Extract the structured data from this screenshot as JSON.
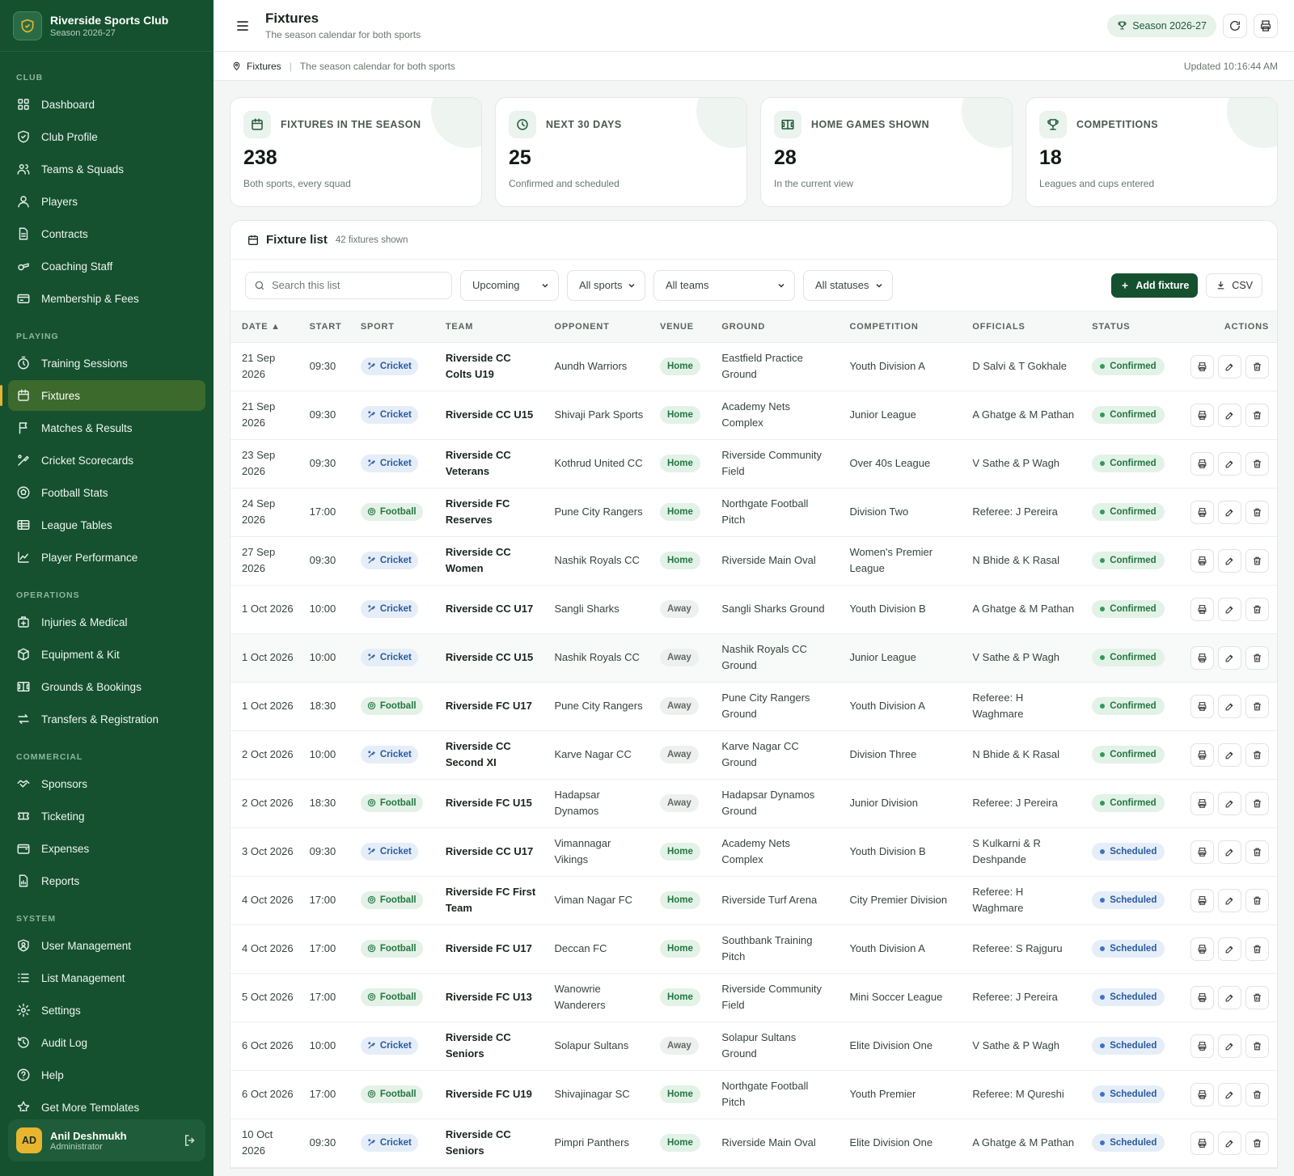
{
  "brand": {
    "name": "Riverside Sports Club",
    "season": "Season 2026-27"
  },
  "nav": {
    "sections": [
      {
        "label": "CLUB",
        "items": [
          {
            "label": "Dashboard",
            "icon": "grid-icon"
          },
          {
            "label": "Club Profile",
            "icon": "shield-icon"
          },
          {
            "label": "Teams & Squads",
            "icon": "users-icon"
          },
          {
            "label": "Players",
            "icon": "user-icon"
          },
          {
            "label": "Contracts",
            "icon": "document-icon"
          },
          {
            "label": "Coaching Staff",
            "icon": "whistle-icon"
          },
          {
            "label": "Membership & Fees",
            "icon": "card-icon"
          }
        ]
      },
      {
        "label": "PLAYING",
        "items": [
          {
            "label": "Training Sessions",
            "icon": "timer-icon"
          },
          {
            "label": "Fixtures",
            "icon": "calendar-icon",
            "active": true
          },
          {
            "label": "Matches & Results",
            "icon": "flag-icon"
          },
          {
            "label": "Cricket Scorecards",
            "icon": "bat-icon"
          },
          {
            "label": "Football Stats",
            "icon": "ball-icon"
          },
          {
            "label": "League Tables",
            "icon": "table-icon"
          },
          {
            "label": "Player Performance",
            "icon": "chart-icon"
          }
        ]
      },
      {
        "label": "OPERATIONS",
        "items": [
          {
            "label": "Injuries & Medical",
            "icon": "medical-icon"
          },
          {
            "label": "Equipment & Kit",
            "icon": "box-icon"
          },
          {
            "label": "Grounds & Bookings",
            "icon": "pitch-icon"
          },
          {
            "label": "Transfers & Registration",
            "icon": "transfer-icon"
          }
        ]
      },
      {
        "label": "COMMERCIAL",
        "items": [
          {
            "label": "Sponsors",
            "icon": "handshake-icon"
          },
          {
            "label": "Ticketing",
            "icon": "ticket-icon"
          },
          {
            "label": "Expenses",
            "icon": "wallet-icon"
          },
          {
            "label": "Reports",
            "icon": "report-icon"
          }
        ]
      },
      {
        "label": "SYSTEM",
        "items": [
          {
            "label": "User Management",
            "icon": "user-shield-icon"
          },
          {
            "label": "List Management",
            "icon": "list-icon"
          },
          {
            "label": "Settings",
            "icon": "gear-icon"
          },
          {
            "label": "Audit Log",
            "icon": "history-icon"
          },
          {
            "label": "Help",
            "icon": "help-icon"
          },
          {
            "label": "Get More Templates",
            "icon": "star-icon"
          }
        ]
      }
    ]
  },
  "user": {
    "initials": "AD",
    "name": "Anil Deshmukh",
    "role": "Administrator"
  },
  "header": {
    "title": "Fixtures",
    "subtitle": "The season calendar for both sports",
    "season_pill": "Season 2026-27"
  },
  "breadcrumb": {
    "current": "Fixtures",
    "description": "The season calendar for both sports",
    "updated": "Updated 10:16:44 AM"
  },
  "stats": [
    {
      "label": "FIXTURES IN THE SEASON",
      "value": "238",
      "note": "Both sports, every squad",
      "icon": "calendar-icon"
    },
    {
      "label": "NEXT 30 DAYS",
      "value": "25",
      "note": "Confirmed and scheduled",
      "icon": "clock-icon"
    },
    {
      "label": "HOME GAMES SHOWN",
      "value": "28",
      "note": "In the current view",
      "icon": "pitch-icon"
    },
    {
      "label": "COMPETITIONS",
      "value": "18",
      "note": "Leagues and cups entered",
      "icon": "trophy-icon"
    }
  ],
  "fixture_list": {
    "title": "Fixture list",
    "count": "42 fixtures shown",
    "search_placeholder": "Search this list",
    "filters": {
      "range": "Upcoming",
      "sport": "All sports",
      "team": "All teams",
      "status": "All statuses"
    },
    "add_label": "Add fixture",
    "csv_label": "CSV",
    "columns": [
      "DATE ▲",
      "START",
      "SPORT",
      "TEAM",
      "OPPONENT",
      "VENUE",
      "GROUND",
      "COMPETITION",
      "OFFICIALS",
      "STATUS",
      "ACTIONS"
    ],
    "rows": [
      {
        "date": "21 Sep 2026",
        "start": "09:30",
        "sport": "Cricket",
        "team": "Riverside CC Colts U19",
        "opponent": "Aundh Warriors",
        "venue": "Home",
        "ground": "Eastfield Practice Ground",
        "competition": "Youth Division A",
        "officials": "D Salvi & T Gokhale",
        "status": "Confirmed"
      },
      {
        "date": "21 Sep 2026",
        "start": "09:30",
        "sport": "Cricket",
        "team": "Riverside CC U15",
        "opponent": "Shivaji Park Sports",
        "venue": "Home",
        "ground": "Academy Nets Complex",
        "competition": "Junior League",
        "officials": "A Ghatge & M Pathan",
        "status": "Confirmed"
      },
      {
        "date": "23 Sep 2026",
        "start": "09:30",
        "sport": "Cricket",
        "team": "Riverside CC Veterans",
        "opponent": "Kothrud United CC",
        "venue": "Home",
        "ground": "Riverside Community Field",
        "competition": "Over 40s League",
        "officials": "V Sathe & P Wagh",
        "status": "Confirmed"
      },
      {
        "date": "24 Sep 2026",
        "start": "17:00",
        "sport": "Football",
        "team": "Riverside FC Reserves",
        "opponent": "Pune City Rangers",
        "venue": "Home",
        "ground": "Northgate Football Pitch",
        "competition": "Division Two",
        "officials": "Referee: J Pereira",
        "status": "Confirmed"
      },
      {
        "date": "27 Sep 2026",
        "start": "09:30",
        "sport": "Cricket",
        "team": "Riverside CC Women",
        "opponent": "Nashik Royals CC",
        "venue": "Home",
        "ground": "Riverside Main Oval",
        "competition": "Women's Premier League",
        "officials": "N Bhide & K Rasal",
        "status": "Confirmed"
      },
      {
        "date": "1 Oct 2026",
        "start": "10:00",
        "sport": "Cricket",
        "team": "Riverside CC U17",
        "opponent": "Sangli Sharks",
        "venue": "Away",
        "ground": "Sangli Sharks Ground",
        "competition": "Youth Division B",
        "officials": "A Ghatge & M Pathan",
        "status": "Confirmed"
      },
      {
        "date": "1 Oct 2026",
        "start": "10:00",
        "sport": "Cricket",
        "team": "Riverside CC U15",
        "opponent": "Nashik Royals CC",
        "venue": "Away",
        "ground": "Nashik Royals CC Ground",
        "competition": "Junior League",
        "officials": "V Sathe & P Wagh",
        "status": "Confirmed",
        "highlight": true
      },
      {
        "date": "1 Oct 2026",
        "start": "18:30",
        "sport": "Football",
        "team": "Riverside FC U17",
        "opponent": "Pune City Rangers",
        "venue": "Away",
        "ground": "Pune City Rangers Ground",
        "competition": "Youth Division A",
        "officials": "Referee: H Waghmare",
        "status": "Confirmed"
      },
      {
        "date": "2 Oct 2026",
        "start": "10:00",
        "sport": "Cricket",
        "team": "Riverside CC Second XI",
        "opponent": "Karve Nagar CC",
        "venue": "Away",
        "ground": "Karve Nagar CC Ground",
        "competition": "Division Three",
        "officials": "N Bhide & K Rasal",
        "status": "Confirmed"
      },
      {
        "date": "2 Oct 2026",
        "start": "18:30",
        "sport": "Football",
        "team": "Riverside FC U15",
        "opponent": "Hadapsar Dynamos",
        "venue": "Away",
        "ground": "Hadapsar Dynamos Ground",
        "competition": "Junior Division",
        "officials": "Referee: J Pereira",
        "status": "Confirmed"
      },
      {
        "date": "3 Oct 2026",
        "start": "09:30",
        "sport": "Cricket",
        "team": "Riverside CC U17",
        "opponent": "Vimannagar Vikings",
        "venue": "Home",
        "ground": "Academy Nets Complex",
        "competition": "Youth Division B",
        "officials": "S Kulkarni & R Deshpande",
        "status": "Scheduled"
      },
      {
        "date": "4 Oct 2026",
        "start": "17:00",
        "sport": "Football",
        "team": "Riverside FC First Team",
        "opponent": "Viman Nagar FC",
        "venue": "Home",
        "ground": "Riverside Turf Arena",
        "competition": "City Premier Division",
        "officials": "Referee: H Waghmare",
        "status": "Scheduled"
      },
      {
        "date": "4 Oct 2026",
        "start": "17:00",
        "sport": "Football",
        "team": "Riverside FC U17",
        "opponent": "Deccan FC",
        "venue": "Home",
        "ground": "Southbank Training Pitch",
        "competition": "Youth Division A",
        "officials": "Referee: S Rajguru",
        "status": "Scheduled"
      },
      {
        "date": "5 Oct 2026",
        "start": "17:00",
        "sport": "Football",
        "team": "Riverside FC U13",
        "opponent": "Wanowrie Wanderers",
        "venue": "Home",
        "ground": "Riverside Community Field",
        "competition": "Mini Soccer League",
        "officials": "Referee: J Pereira",
        "status": "Scheduled"
      },
      {
        "date": "6 Oct 2026",
        "start": "10:00",
        "sport": "Cricket",
        "team": "Riverside CC Seniors",
        "opponent": "Solapur Sultans",
        "venue": "Away",
        "ground": "Solapur Sultans Ground",
        "competition": "Elite Division One",
        "officials": "V Sathe & P Wagh",
        "status": "Scheduled"
      },
      {
        "date": "6 Oct 2026",
        "start": "17:00",
        "sport": "Football",
        "team": "Riverside FC U19",
        "opponent": "Shivajinagar SC",
        "venue": "Home",
        "ground": "Northgate Football Pitch",
        "competition": "Youth Premier",
        "officials": "Referee: M Qureshi",
        "status": "Scheduled"
      },
      {
        "date": "10 Oct 2026",
        "start": "09:30",
        "sport": "Cricket",
        "team": "Riverside CC Seniors",
        "opponent": "Pimpri Panthers",
        "venue": "Home",
        "ground": "Riverside Main Oval",
        "competition": "Elite Division One",
        "officials": "A Ghatge & M Pathan",
        "status": "Scheduled"
      }
    ]
  },
  "colors": {
    "sidebar": "#15512f",
    "accent": "#e5b431",
    "active": "#3c6a2c"
  }
}
